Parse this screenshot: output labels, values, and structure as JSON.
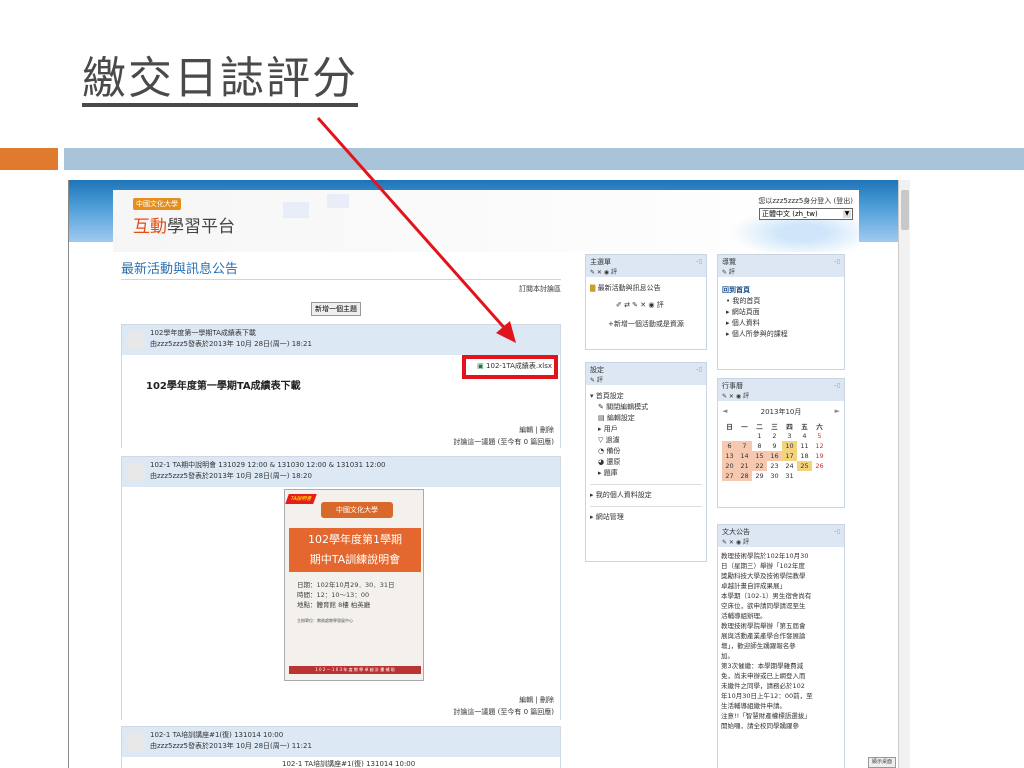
{
  "slide": {
    "title": "繳交日誌評分"
  },
  "site": {
    "logo_small": "中國文化大學",
    "logo_brand": "互動",
    "logo_rest": "學習平台",
    "login_text": "您以zzz5zzz5身分登入 (登出)",
    "language": "正體中文 (zh_tw)"
  },
  "forum": {
    "title": "最新活動與訊息公告",
    "subscribe": "訂閱本討論區",
    "new_topic": "新增一個主題",
    "posts": [
      {
        "subject": "102學年度第一學期TA成績表下載",
        "meta": "由zzz5zzz5發表於2013年 10月 28日(周一) 18:21",
        "attachment": "102-1TA成績表.xlsx",
        "heading": "102學年度第一學期TA成績表下載",
        "edit": "編輯 | 刪除",
        "reply": "討論這一議題 (至今有 0 篇回應)"
      },
      {
        "subject": "102-1 TA期中說明會 131029 12:00 & 131030 12:00 & 131031 12:00",
        "meta": "由zzz5zzz5發表於2013年 10月 28日(周一) 18:20",
        "edit": "編輯 | 刪除",
        "reply": "討論這一議題 (至今有 0 篇回應)"
      },
      {
        "subject": "102-1 TA培訓講座#1(復) 131014 10:00",
        "meta": "由zzz5zzz5發表於2013年 10月 28日(周一) 11:21",
        "body_line": "102-1 TA培訓講座#1(復) 131014 10:00"
      }
    ],
    "poster": {
      "star": "TA說明會",
      "school": "中國文化大學",
      "line1": "102學年度第1學期",
      "line2": "期中TA訓練說明會",
      "info1": "日期：102年10月29．30．31日",
      "info2": "時間：12：10～13：00",
      "info3": "地點：體育館 8樓 柏英廳",
      "small": "主辦單位：教務處教學發展中心",
      "strip": "1 0 2 — 1 0 3 年 度 教 學 卓 越 計 畫 補 助"
    }
  },
  "blocks": {
    "menu": {
      "title": "主選單",
      "icons": "✎ ✕ ◉ 評",
      "item1": "最新活動與訊息公告",
      "tools": "✐ ⇄ ✎ ✕ ◉ 評",
      "add": "+新增一個活動或是資源"
    },
    "settings": {
      "title": "設定",
      "icons": "✎ 評",
      "items": [
        "首頁設定",
        "關閉編輯模式",
        "編輯設定",
        "用戶",
        "過濾",
        "備份",
        "還原",
        "題庫"
      ],
      "profile": "我的個人資料設定",
      "site_admin": "網站管理"
    },
    "nav": {
      "title": "導覽",
      "icons": "✎ 評",
      "home": "回到首頁",
      "items": [
        "我的首頁",
        "網站頁面",
        "個人資料",
        "個人所參與的課程"
      ]
    },
    "calendar": {
      "title": "行事曆",
      "icons": "✎ ✕ ◉ 評",
      "month": "2013年10月",
      "prev": "◄",
      "next": "►",
      "weekdays": [
        "日",
        "一",
        "二",
        "三",
        "四",
        "五",
        "六"
      ],
      "rows": [
        [
          "",
          "",
          "1",
          "2",
          "3",
          "4",
          "5"
        ],
        [
          "6",
          "7",
          "8",
          "9",
          "10",
          "11",
          "12"
        ],
        [
          "13",
          "14",
          "15",
          "16",
          "17",
          "18",
          "19"
        ],
        [
          "20",
          "21",
          "22",
          "23",
          "24",
          "25",
          "26"
        ],
        [
          "27",
          "28",
          "29",
          "30",
          "31",
          "",
          ""
        ]
      ]
    },
    "news": {
      "title": "文大公告",
      "icons": "✎ ✕ ◉ 評",
      "lines": [
        "教理技術學院於102年10月30",
        "日（星期三）舉辦「102年度",
        "獎勵科技大學及技術學院教學",
        "卓越計畫自評成果展」",
        "本學期（102-1）男生宿舍尚有",
        "空床位，欲申請同學請逕至生",
        "活輔導組辦理。",
        "教理技術學院舉辦「第五屆會",
        "展與活動產業產學合作發展論",
        "壇」，歡迎師生踴躍報名參",
        "加。",
        "第3次催繳：本學期學雜費減",
        "免，尚未申辦或已上網登入而",
        "未繳件之同學，請務必於102",
        "年10月30日上午12：00前，至",
        "生活輔導組繳件申請。",
        "注意!!「智慧財產權標語選拔」",
        "開始囉，請全校同學踴躍參"
      ]
    }
  },
  "corner_tag": "顯示桌面"
}
